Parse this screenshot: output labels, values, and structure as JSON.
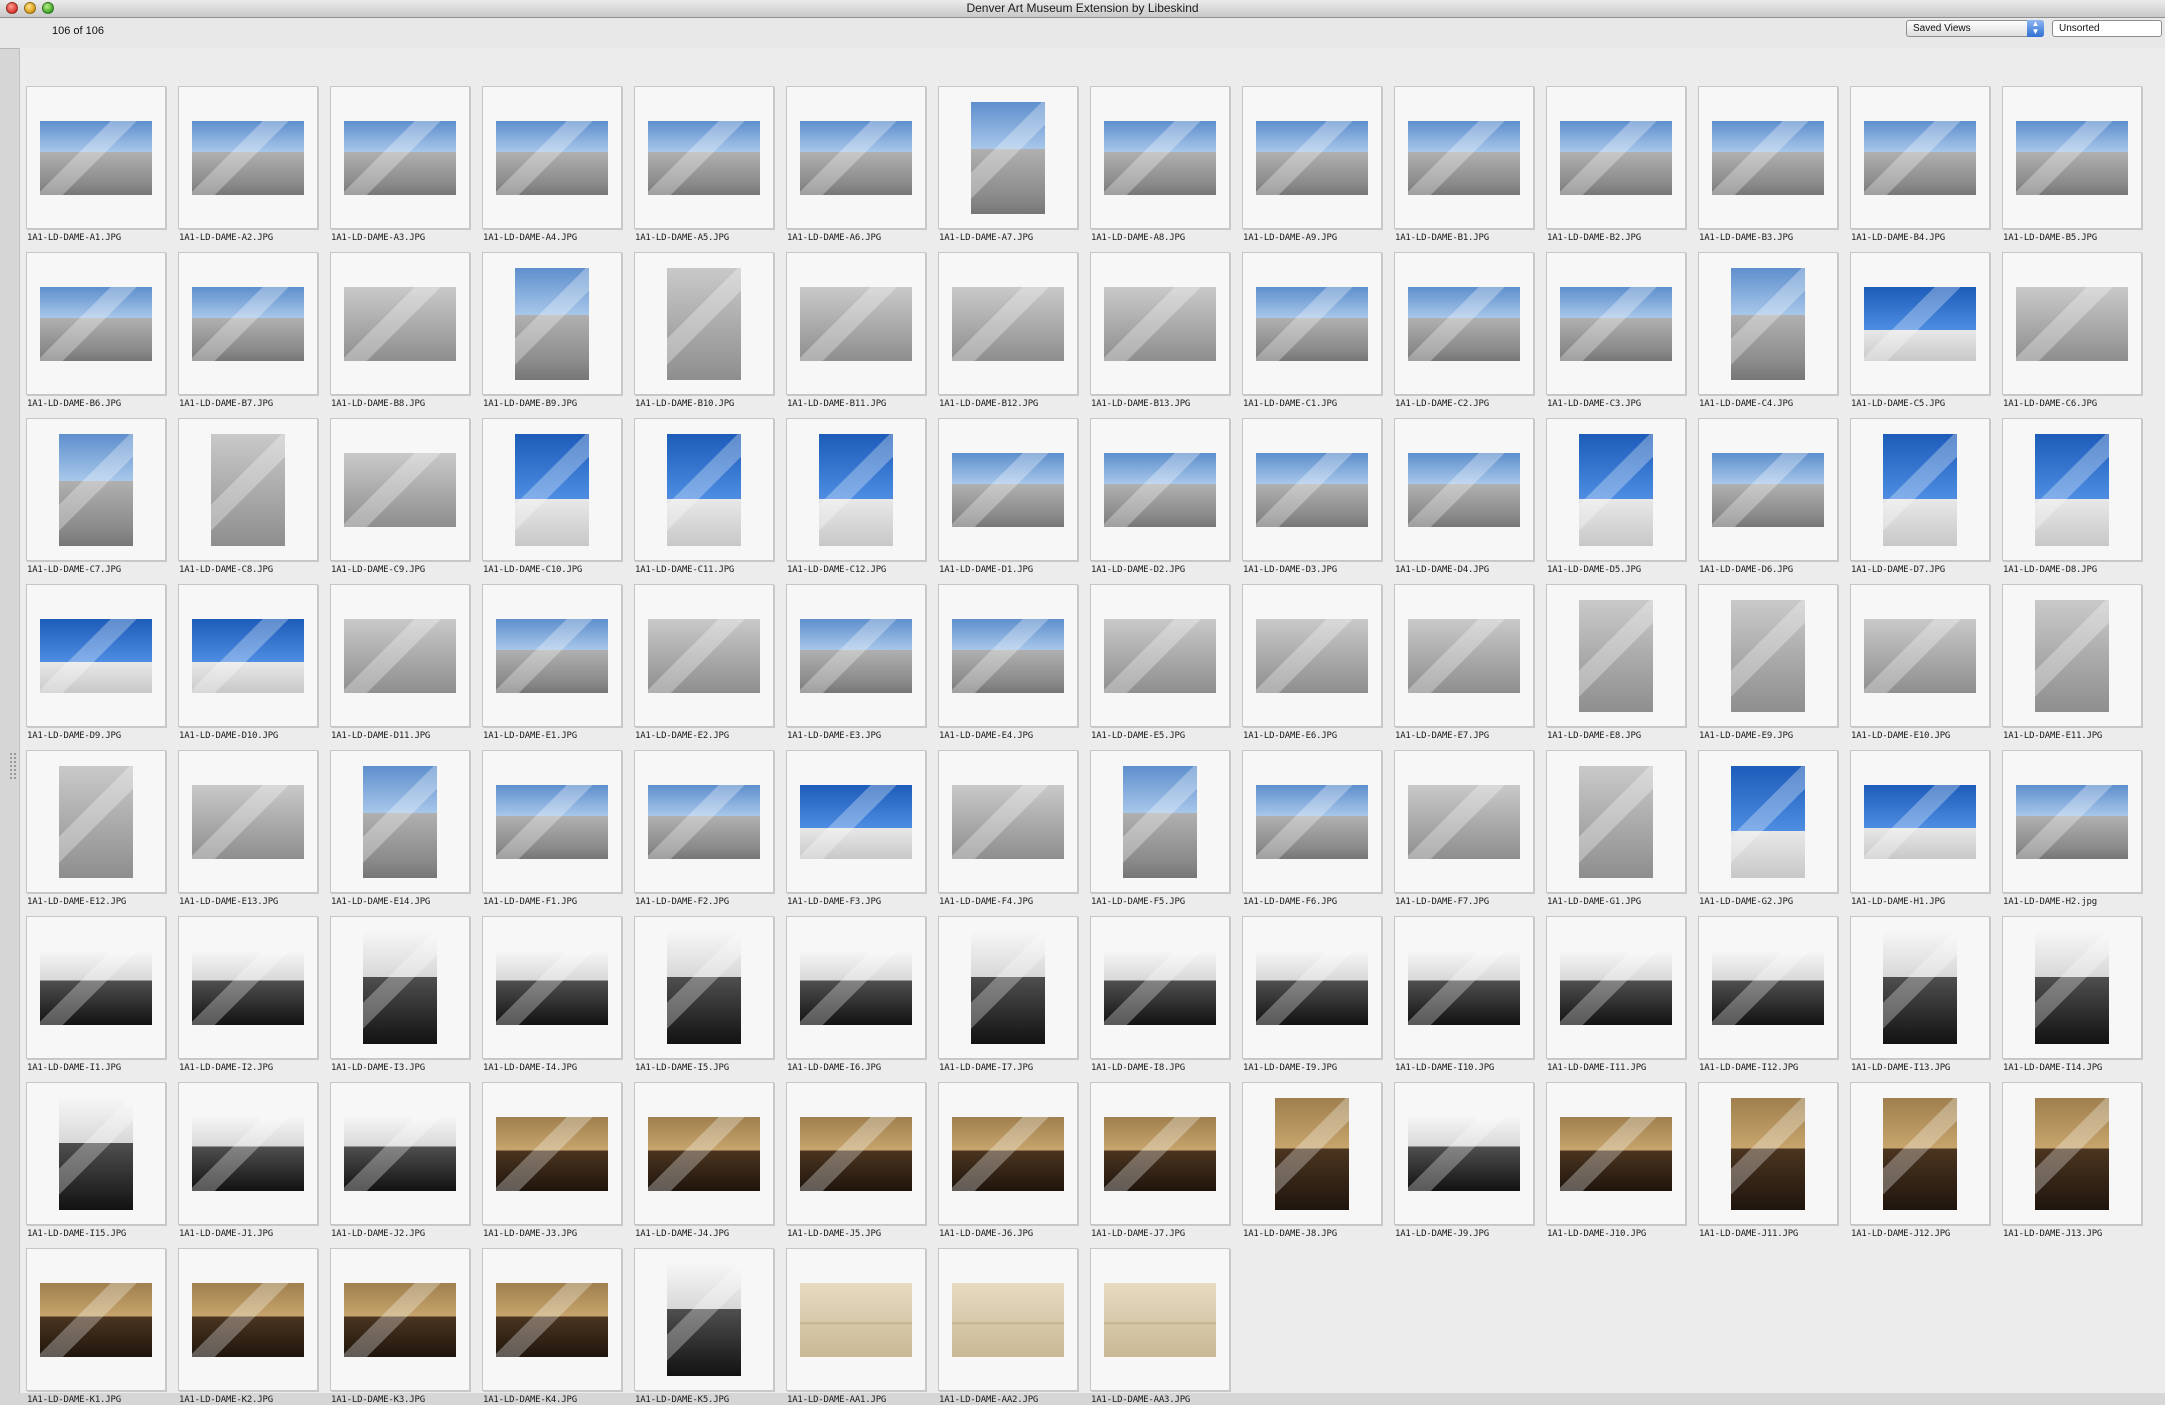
{
  "window": {
    "title": "Denver Art Museum Extension by Libeskind"
  },
  "toolbar": {
    "count": "106 of 106",
    "saved_views": "Saved Views",
    "sort": "Unsorted"
  },
  "thumbnails": [
    {
      "file": "1A1-LD-DAME-A1.JPG",
      "kind": "sky"
    },
    {
      "file": "1A1-LD-DAME-A2.JPG",
      "kind": "sky"
    },
    {
      "file": "1A1-LD-DAME-A3.JPG",
      "kind": "sky"
    },
    {
      "file": "1A1-LD-DAME-A4.JPG",
      "kind": "sky"
    },
    {
      "file": "1A1-LD-DAME-A5.JPG",
      "kind": "sky"
    },
    {
      "file": "1A1-LD-DAME-A6.JPG",
      "kind": "sky"
    },
    {
      "file": "1A1-LD-DAME-A7.JPG",
      "kind": "sky",
      "portrait": true
    },
    {
      "file": "1A1-LD-DAME-A8.JPG",
      "kind": "sky"
    },
    {
      "file": "1A1-LD-DAME-A9.JPG",
      "kind": "sky"
    },
    {
      "file": "1A1-LD-DAME-B1.JPG",
      "kind": "sky"
    },
    {
      "file": "1A1-LD-DAME-B2.JPG",
      "kind": "sky"
    },
    {
      "file": "1A1-LD-DAME-B3.JPG",
      "kind": "sky"
    },
    {
      "file": "1A1-LD-DAME-B4.JPG",
      "kind": "sky"
    },
    {
      "file": "1A1-LD-DAME-B5.JPG",
      "kind": "sky"
    },
    {
      "file": "1A1-LD-DAME-B6.JPG",
      "kind": "sky"
    },
    {
      "file": "1A1-LD-DAME-B7.JPG",
      "kind": "sky"
    },
    {
      "file": "1A1-LD-DAME-B8.JPG",
      "kind": "gray"
    },
    {
      "file": "1A1-LD-DAME-B9.JPG",
      "kind": "sky",
      "portrait": true
    },
    {
      "file": "1A1-LD-DAME-B10.JPG",
      "kind": "gray",
      "portrait": true
    },
    {
      "file": "1A1-LD-DAME-B11.JPG",
      "kind": "gray"
    },
    {
      "file": "1A1-LD-DAME-B12.JPG",
      "kind": "gray"
    },
    {
      "file": "1A1-LD-DAME-B13.JPG",
      "kind": "gray"
    },
    {
      "file": "1A1-LD-DAME-C1.JPG",
      "kind": "sky"
    },
    {
      "file": "1A1-LD-DAME-C2.JPG",
      "kind": "sky"
    },
    {
      "file": "1A1-LD-DAME-C3.JPG",
      "kind": "sky"
    },
    {
      "file": "1A1-LD-DAME-C4.JPG",
      "kind": "sky",
      "portrait": true
    },
    {
      "file": "1A1-LD-DAME-C5.JPG",
      "kind": "blue"
    },
    {
      "file": "1A1-LD-DAME-C6.JPG",
      "kind": "gray"
    },
    {
      "file": "1A1-LD-DAME-C7.JPG",
      "kind": "sky",
      "portrait": true
    },
    {
      "file": "1A1-LD-DAME-C8.JPG",
      "kind": "gray",
      "portrait": true
    },
    {
      "file": "1A1-LD-DAME-C9.JPG",
      "kind": "gray"
    },
    {
      "file": "1A1-LD-DAME-C10.JPG",
      "kind": "blue",
      "portrait": true
    },
    {
      "file": "1A1-LD-DAME-C11.JPG",
      "kind": "blue",
      "portrait": true
    },
    {
      "file": "1A1-LD-DAME-C12.JPG",
      "kind": "blue",
      "portrait": true
    },
    {
      "file": "1A1-LD-DAME-D1.JPG",
      "kind": "sky"
    },
    {
      "file": "1A1-LD-DAME-D2.JPG",
      "kind": "sky"
    },
    {
      "file": "1A1-LD-DAME-D3.JPG",
      "kind": "sky"
    },
    {
      "file": "1A1-LD-DAME-D4.JPG",
      "kind": "sky"
    },
    {
      "file": "1A1-LD-DAME-D5.JPG",
      "kind": "blue",
      "portrait": true
    },
    {
      "file": "1A1-LD-DAME-D6.JPG",
      "kind": "sky"
    },
    {
      "file": "1A1-LD-DAME-D7.JPG",
      "kind": "blue",
      "portrait": true
    },
    {
      "file": "1A1-LD-DAME-D8.JPG",
      "kind": "blue",
      "portrait": true
    },
    {
      "file": "1A1-LD-DAME-D9.JPG",
      "kind": "blue"
    },
    {
      "file": "1A1-LD-DAME-D10.JPG",
      "kind": "blue"
    },
    {
      "file": "1A1-LD-DAME-D11.JPG",
      "kind": "gray"
    },
    {
      "file": "1A1-LD-DAME-E1.JPG",
      "kind": "sky"
    },
    {
      "file": "1A1-LD-DAME-E2.JPG",
      "kind": "gray"
    },
    {
      "file": "1A1-LD-DAME-E3.JPG",
      "kind": "sky"
    },
    {
      "file": "1A1-LD-DAME-E4.JPG",
      "kind": "sky"
    },
    {
      "file": "1A1-LD-DAME-E5.JPG",
      "kind": "gray"
    },
    {
      "file": "1A1-LD-DAME-E6.JPG",
      "kind": "gray"
    },
    {
      "file": "1A1-LD-DAME-E7.JPG",
      "kind": "gray"
    },
    {
      "file": "1A1-LD-DAME-E8.JPG",
      "kind": "gray",
      "portrait": true
    },
    {
      "file": "1A1-LD-DAME-E9.JPG",
      "kind": "gray",
      "portrait": true
    },
    {
      "file": "1A1-LD-DAME-E10.JPG",
      "kind": "gray"
    },
    {
      "file": "1A1-LD-DAME-E11.JPG",
      "kind": "gray",
      "portrait": true
    },
    {
      "file": "1A1-LD-DAME-E12.JPG",
      "kind": "gray",
      "portrait": true
    },
    {
      "file": "1A1-LD-DAME-E13.JPG",
      "kind": "gray"
    },
    {
      "file": "1A1-LD-DAME-E14.JPG",
      "kind": "sky",
      "portrait": true
    },
    {
      "file": "1A1-LD-DAME-F1.JPG",
      "kind": "sky"
    },
    {
      "file": "1A1-LD-DAME-F2.JPG",
      "kind": "sky"
    },
    {
      "file": "1A1-LD-DAME-F3.JPG",
      "kind": "blue"
    },
    {
      "file": "1A1-LD-DAME-F4.JPG",
      "kind": "gray"
    },
    {
      "file": "1A1-LD-DAME-F5.JPG",
      "kind": "sky",
      "portrait": true
    },
    {
      "file": "1A1-LD-DAME-F6.JPG",
      "kind": "sky"
    },
    {
      "file": "1A1-LD-DAME-F7.JPG",
      "kind": "gray"
    },
    {
      "file": "1A1-LD-DAME-G1.JPG",
      "kind": "gray",
      "portrait": true
    },
    {
      "file": "1A1-LD-DAME-G2.JPG",
      "kind": "blue",
      "portrait": true
    },
    {
      "file": "1A1-LD-DAME-H1.JPG",
      "kind": "blue"
    },
    {
      "file": "1A1-LD-DAME-H2.jpg",
      "kind": "sky"
    },
    {
      "file": "1A1-LD-DAME-I1.JPG",
      "kind": "interior"
    },
    {
      "file": "1A1-LD-DAME-I2.JPG",
      "kind": "interior"
    },
    {
      "file": "1A1-LD-DAME-I3.JPG",
      "kind": "interior",
      "portrait": true
    },
    {
      "file": "1A1-LD-DAME-I4.JPG",
      "kind": "interior"
    },
    {
      "file": "1A1-LD-DAME-I5.JPG",
      "kind": "interior",
      "portrait": true
    },
    {
      "file": "1A1-LD-DAME-I6.JPG",
      "kind": "interior"
    },
    {
      "file": "1A1-LD-DAME-I7.JPG",
      "kind": "interior",
      "portrait": true
    },
    {
      "file": "1A1-LD-DAME-I8.JPG",
      "kind": "interior"
    },
    {
      "file": "1A1-LD-DAME-I9.JPG",
      "kind": "interior"
    },
    {
      "file": "1A1-LD-DAME-I10.JPG",
      "kind": "interior"
    },
    {
      "file": "1A1-LD-DAME-I11.JPG",
      "kind": "interior"
    },
    {
      "file": "1A1-LD-DAME-I12.JPG",
      "kind": "interior"
    },
    {
      "file": "1A1-LD-DAME-I13.JPG",
      "kind": "interior",
      "portrait": true
    },
    {
      "file": "1A1-LD-DAME-I14.JPG",
      "kind": "interior",
      "portrait": true
    },
    {
      "file": "1A1-LD-DAME-I15.JPG",
      "kind": "interior",
      "portrait": true
    },
    {
      "file": "1A1-LD-DAME-J1.JPG",
      "kind": "interior"
    },
    {
      "file": "1A1-LD-DAME-J2.JPG",
      "kind": "interior"
    },
    {
      "file": "1A1-LD-DAME-J3.JPG",
      "kind": "gallery"
    },
    {
      "file": "1A1-LD-DAME-J4.JPG",
      "kind": "gallery"
    },
    {
      "file": "1A1-LD-DAME-J5.JPG",
      "kind": "gallery"
    },
    {
      "file": "1A1-LD-DAME-J6.JPG",
      "kind": "gallery"
    },
    {
      "file": "1A1-LD-DAME-J7.JPG",
      "kind": "gallery"
    },
    {
      "file": "1A1-LD-DAME-J8.JPG",
      "kind": "gallery",
      "portrait": true
    },
    {
      "file": "1A1-LD-DAME-J9.JPG",
      "kind": "interior"
    },
    {
      "file": "1A1-LD-DAME-J10.JPG",
      "kind": "gallery"
    },
    {
      "file": "1A1-LD-DAME-J11.JPG",
      "kind": "gallery",
      "portrait": true
    },
    {
      "file": "1A1-LD-DAME-J12.JPG",
      "kind": "gallery",
      "portrait": true
    },
    {
      "file": "1A1-LD-DAME-J13.JPG",
      "kind": "gallery",
      "portrait": true
    },
    {
      "file": "1A1-LD-DAME-K1.JPG",
      "kind": "gallery"
    },
    {
      "file": "1A1-LD-DAME-K2.JPG",
      "kind": "gallery"
    },
    {
      "file": "1A1-LD-DAME-K3.JPG",
      "kind": "gallery"
    },
    {
      "file": "1A1-LD-DAME-K4.JPG",
      "kind": "gallery"
    },
    {
      "file": "1A1-LD-DAME-K5.JPG",
      "kind": "interior",
      "portrait": true
    },
    {
      "file": "1A1-LD-DAME-AA1.JPG",
      "kind": "paper"
    },
    {
      "file": "1A1-LD-DAME-AA2.JPG",
      "kind": "paper"
    },
    {
      "file": "1A1-LD-DAME-AA3.JPG",
      "kind": "paper"
    }
  ]
}
